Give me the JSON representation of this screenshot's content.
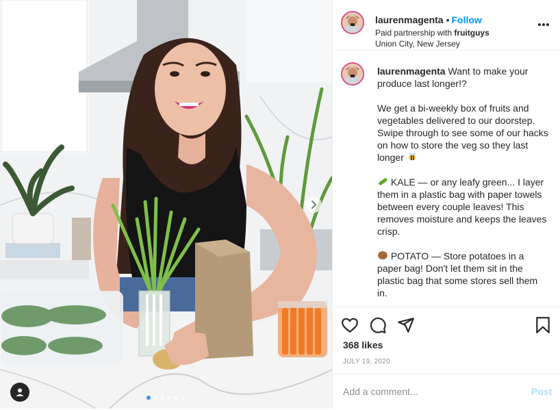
{
  "post": {
    "username": "laurenmagenta",
    "follow_label": "Follow",
    "separator": "•",
    "partnership_prefix": "Paid partnership with",
    "partner": "fruitguys",
    "location": "Union City, New Jersey"
  },
  "caption": {
    "username": "laurenmagenta",
    "intro": "Want to make your produce last longer!?",
    "p2": "We get a bi-weekly box of fruits and vegetables delivered to our doorstep. Swipe through to see some of our hacks on how to store the veg so they last longer",
    "p3": "KALE — or any leafy green... I layer them in a plastic bag with paper towels between every couple leaves! This removes moisture and keeps the leaves crisp.",
    "p4": "POTATO — Store potatoes in a paper bag! Don't let them sit in the plastic bag that some stores sell them in."
  },
  "stats": {
    "likes": "368 likes",
    "date": "JULY 19, 2020"
  },
  "comment": {
    "placeholder": "Add a comment...",
    "post_label": "Post"
  },
  "carousel": {
    "total": 6,
    "active": 1
  },
  "colors": {
    "follow": "#0095f6",
    "post_disabled": "#b2dffc",
    "active_dot": "#3897f0",
    "avatar_ring": "#d84d8a"
  },
  "icons": [
    "more-options-icon",
    "heart-icon",
    "comment-icon",
    "share-icon",
    "bookmark-icon",
    "chevron-right-icon",
    "user-tag-icon",
    "bee-emoji",
    "cucumber-emoji",
    "potato-emoji"
  ]
}
